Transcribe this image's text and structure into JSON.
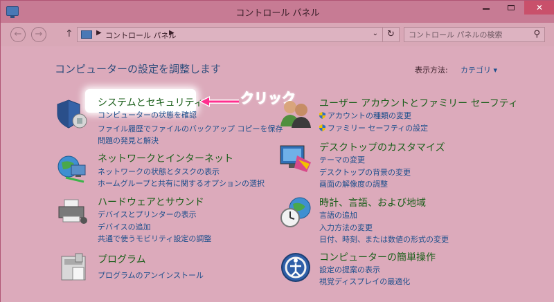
{
  "window": {
    "title": "コントロール パネル"
  },
  "nav": {
    "address": "コントロール パネル",
    "search_placeholder": "コントロール パネルの検索"
  },
  "content": {
    "heading": "コンピューターの設定を調整します",
    "view_by_label": "表示方法:",
    "view_by_value": "カテゴリ",
    "callout": "クリック",
    "categories": [
      {
        "title": "システムとセキュリティ",
        "links": [
          "コンピューターの状態を確認",
          "ファイル履歴でファイルのバックアップ コピーを保存",
          "問題の発見と解決"
        ],
        "icon": "security-shield-icon"
      },
      {
        "title": "ネットワークとインターネット",
        "links": [
          "ネットワークの状態とタスクの表示",
          "ホームグループと共有に関するオプションの選択"
        ],
        "icon": "network-globe-icon"
      },
      {
        "title": "ハードウェアとサウンド",
        "links": [
          "デバイスとプリンターの表示",
          "デバイスの追加",
          "共通で使うモビリティ設定の調整"
        ],
        "icon": "printer-icon"
      },
      {
        "title": "プログラム",
        "links": [
          "プログラムのアンインストール"
        ],
        "icon": "programs-icon"
      },
      {
        "title": "ユーザー アカウントとファミリー セーフティ",
        "links": [
          "アカウントの種類の変更",
          "ファミリー セーフティの設定"
        ],
        "icon": "users-icon"
      },
      {
        "title": "デスクトップのカスタマイズ",
        "links": [
          "テーマの変更",
          "デスクトップの背景の変更",
          "画面の解像度の調整"
        ],
        "icon": "monitor-icon"
      },
      {
        "title": "時計、言語、および地域",
        "links": [
          "言語の追加",
          "入力方法の変更",
          "日付、時刻、または数値の形式の変更"
        ],
        "icon": "clock-globe-icon"
      },
      {
        "title": "コンピューターの簡単操作",
        "links": [
          "設定の提案の表示",
          "視覚ディスプレイの最適化"
        ],
        "icon": "accessibility-icon"
      }
    ]
  },
  "colors": {
    "title_green": "#1a5f1a",
    "link_blue": "#1d4f8c",
    "callout_pink": "#ff2f8e"
  }
}
